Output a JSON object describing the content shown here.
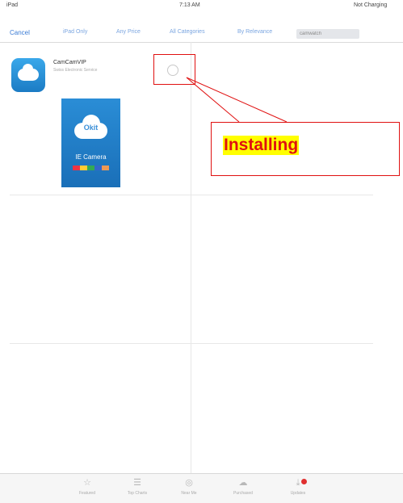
{
  "status_bar": {
    "carrier": "iPad",
    "time": "7:13 AM",
    "battery": "Not Charging"
  },
  "navbar": {
    "cancel": "Cancel",
    "filters": [
      "iPad Only",
      "Any Price",
      "All Categories",
      "By Relevance"
    ],
    "search_value": "camwatch"
  },
  "app": {
    "name": "CamCamVIP",
    "subtitle": "Swiss Electronic Service"
  },
  "screenshot": {
    "logo": "Okit",
    "title": "IE Camera"
  },
  "annotation": {
    "label": "Installing",
    "color": "#e01010",
    "highlight": "#ffff00"
  },
  "tabs": [
    {
      "label": "Featured",
      "icon": "star-icon"
    },
    {
      "label": "Top Charts",
      "icon": "list-icon"
    },
    {
      "label": "Near Me",
      "icon": "location-icon"
    },
    {
      "label": "Purchased",
      "icon": "cloud-icon"
    },
    {
      "label": "Updates",
      "icon": "download-icon"
    }
  ],
  "colors": {
    "accent": "#3a7bd5",
    "icon_blue": "#1b7bc4"
  }
}
